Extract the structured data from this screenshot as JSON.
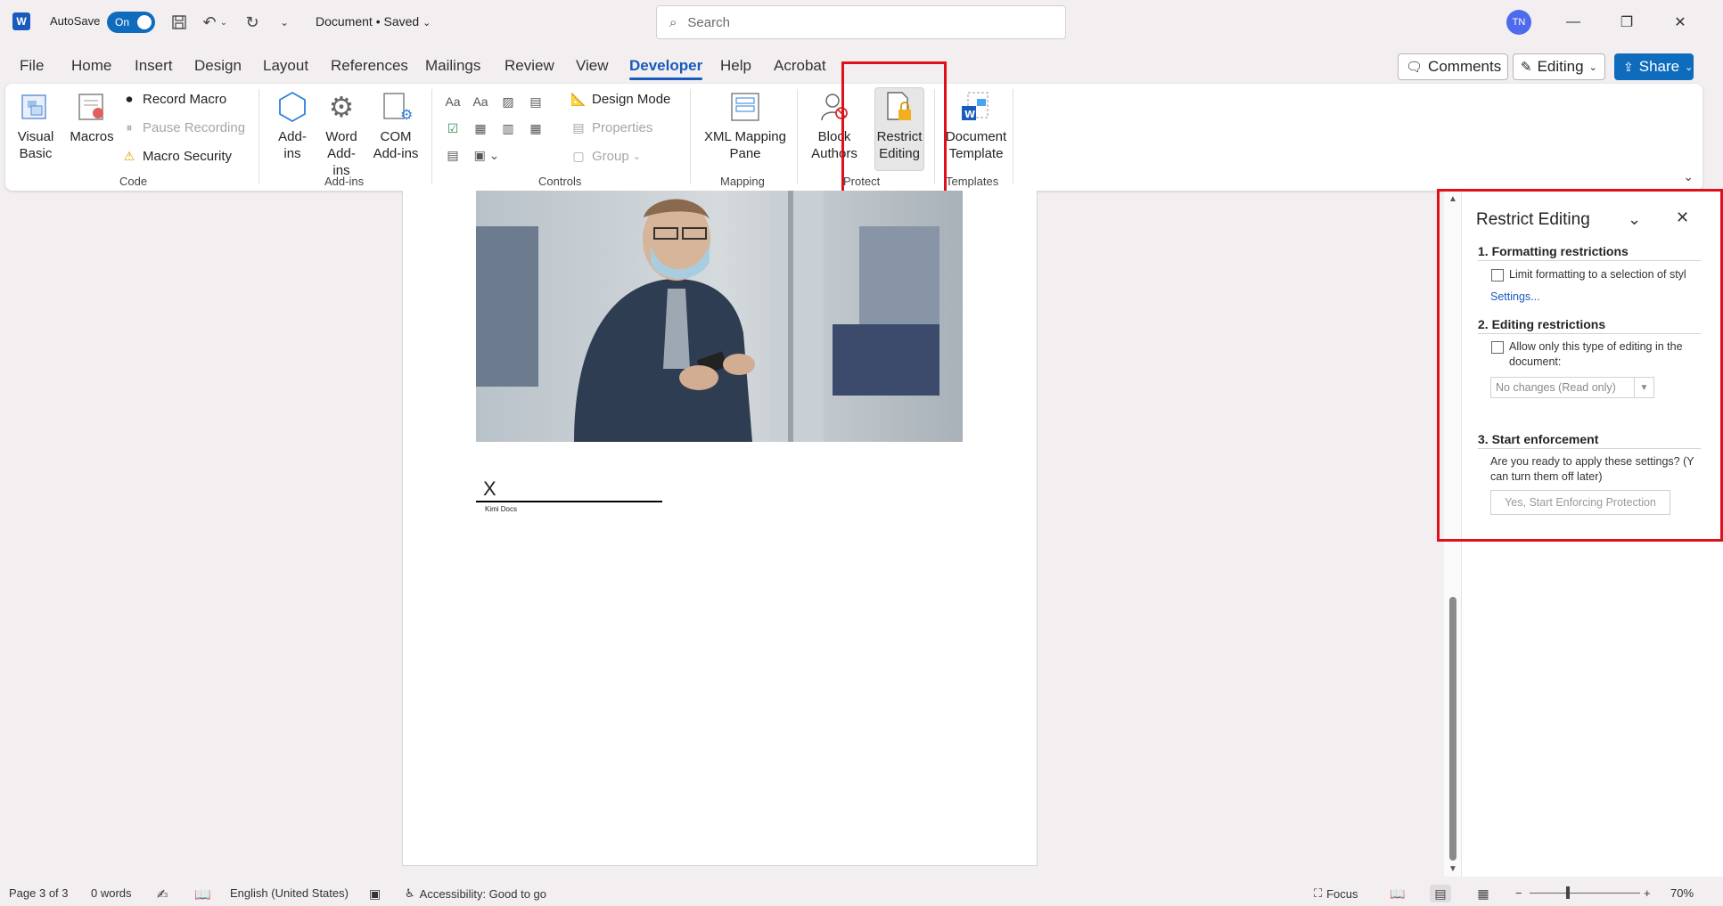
{
  "titlebar": {
    "app_logo": "W",
    "autosave_label": "AutoSave",
    "autosave_state": "On",
    "doc_title": "Document • Saved",
    "search_placeholder": "Search",
    "user_initials": "TN"
  },
  "menu": {
    "tabs": [
      "File",
      "Home",
      "Insert",
      "Design",
      "Layout",
      "References",
      "Mailings",
      "Review",
      "View",
      "Developer",
      "Help",
      "Acrobat"
    ],
    "active_tab": "Developer",
    "comments_label": "Comments",
    "editing_label": "Editing",
    "share_label": "Share"
  },
  "ribbon": {
    "code": {
      "visual_basic": "Visual Basic",
      "macros": "Macros",
      "record_macro": "Record Macro",
      "pause_recording": "Pause Recording",
      "macro_security": "Macro Security",
      "group_label": "Code"
    },
    "addins": {
      "addins": "Add-ins",
      "word_addins": "Word Add-ins",
      "com_addins": "COM Add-ins",
      "group_label": "Add-ins"
    },
    "controls": {
      "design_mode": "Design Mode",
      "properties": "Properties",
      "group": "Group",
      "group_label": "Controls"
    },
    "mapping": {
      "xml_mapping_pane": "XML Mapping Pane",
      "group_label": "Mapping"
    },
    "protect": {
      "block_authors": "Block Authors",
      "restrict_editing": "Restrict Editing",
      "group_label": "Protect"
    },
    "templates": {
      "document_template": "Document Template",
      "group_label": "Templates"
    }
  },
  "document": {
    "signature_x": "X",
    "signature_name": "Kimi Docs"
  },
  "panel": {
    "title": "Restrict Editing",
    "section1_title": "1. Formatting restrictions",
    "section1_checkbox": "Limit formatting to a selection of styl",
    "settings_link": "Settings...",
    "section2_title": "2. Editing restrictions",
    "section2_checkbox_line1": "Allow only this type of editing in the",
    "section2_checkbox_line2": "document:",
    "editing_type": "No changes (Read only)",
    "section3_title": "3. Start enforcement",
    "section3_text_line1": "Are you ready to apply these settings? (Y",
    "section3_text_line2": "can turn them off later)",
    "start_button": "Yes, Start Enforcing Protection"
  },
  "statusbar": {
    "page": "Page 3 of 3",
    "words": "0 words",
    "language": "English (United States)",
    "accessibility": "Accessibility: Good to go",
    "focus": "Focus",
    "zoom": "70%"
  },
  "colors": {
    "accent": "#185abd",
    "highlight_box": "#e0101a"
  }
}
